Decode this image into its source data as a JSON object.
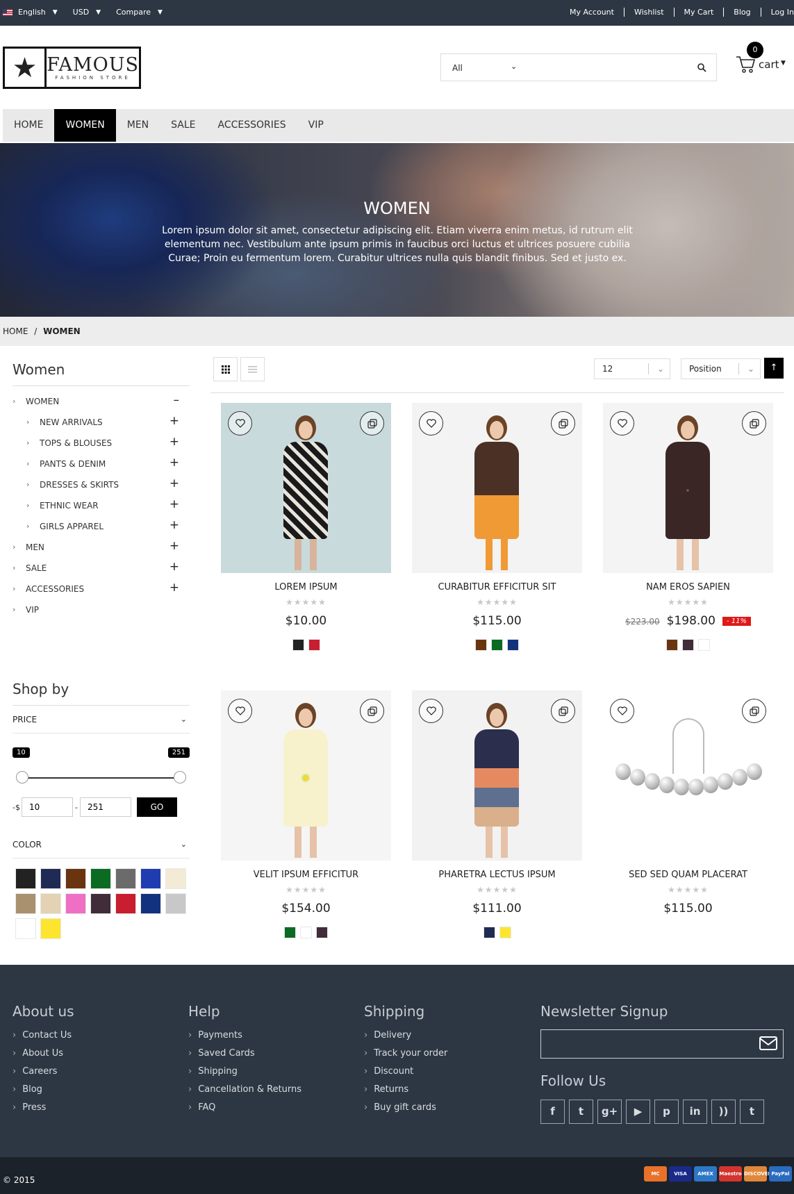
{
  "topbar": {
    "language": "English",
    "currency": "USD",
    "compare": "Compare",
    "links": [
      "My Account",
      "Wishlist",
      "My Cart",
      "Blog",
      "Log In"
    ]
  },
  "logo": {
    "name": "FAMOUS",
    "tagline": "FASHION STORE",
    "icon": "star-icon"
  },
  "search": {
    "category": "All",
    "icon": "search-icon"
  },
  "cart": {
    "count": "0",
    "label": "cart",
    "icon": "cart-icon"
  },
  "nav": {
    "items": [
      "HOME",
      "WOMEN",
      "MEN",
      "SALE",
      "ACCESSORIES",
      "VIP"
    ],
    "active": "WOMEN"
  },
  "banner": {
    "title": "WOMEN",
    "text": "Lorem ipsum dolor sit amet, consectetur adipiscing elit. Etiam viverra enim metus, id rutrum elit elementum nec. Vestibulum ante ipsum primis in faucibus orci luctus et ultrices posuere cubilia Curae; Proin eu fermentum lorem. Curabitur ultrices nulla quis blandit finibus. Sed et justo ex."
  },
  "breadcrumb": {
    "home": "HOME",
    "sep": "/",
    "current": "WOMEN"
  },
  "sidebar": {
    "title": "Women",
    "categories": [
      {
        "label": "WOMEN",
        "level": 0,
        "toggle": "–"
      },
      {
        "label": "NEW ARRIVALS",
        "level": 1,
        "toggle": "+"
      },
      {
        "label": "TOPS & BLOUSES",
        "level": 1,
        "toggle": "+"
      },
      {
        "label": "PANTS & DENIM",
        "level": 1,
        "toggle": "+"
      },
      {
        "label": "DRESSES & SKIRTS",
        "level": 1,
        "toggle": "+"
      },
      {
        "label": "ETHNIC WEAR",
        "level": 1,
        "toggle": "+"
      },
      {
        "label": "GIRLS APPAREL",
        "level": 1,
        "toggle": "+"
      },
      {
        "label": "MEN",
        "level": 0,
        "toggle": "+"
      },
      {
        "label": "SALE",
        "level": 0,
        "toggle": "+"
      },
      {
        "label": "ACCESSORIES",
        "level": 0,
        "toggle": "+"
      },
      {
        "label": "VIP",
        "level": 0,
        "toggle": ""
      }
    ]
  },
  "shopby": {
    "title": "Shop by",
    "price_label": "PRICE",
    "price_min": "10",
    "price_max": "251",
    "currency_prefix": "-$",
    "range_sep": "-",
    "go": "GO",
    "color_label": "COLOR",
    "colors": [
      "#222222",
      "#1f2a55",
      "#6b3410",
      "#0b6b22",
      "#6b6b6b",
      "#1f3cb0",
      "#f3ebd6",
      "#a9916f",
      "#e3d3b4",
      "#ef6fc4",
      "#412c39",
      "#c81e30",
      "#13327d",
      "#c8c8c8",
      "#ffffff",
      "#fde52f"
    ]
  },
  "toolbar": {
    "limit": "12",
    "sort": "Position",
    "sort_dir_icon": "arrow-up-icon",
    "grid_icon": "grid-icon",
    "list_icon": "list-icon"
  },
  "products": [
    {
      "name": "LOREM IPSUM",
      "price": "$10.00",
      "old_price": "",
      "discount": "",
      "stars": "★★★★★",
      "colors": [
        "#222222",
        "#c81e30"
      ],
      "image": "giraffe-print-dress"
    },
    {
      "name": "CURABITUR EFFICITUR SIT",
      "price": "$115.00",
      "old_price": "",
      "discount": "",
      "stars": "★★★★★",
      "colors": [
        "#6b3410",
        "#0b6b22",
        "#13327d"
      ],
      "image": "brown-top-orange-pants"
    },
    {
      "name": "NAM EROS SAPIEN",
      "price": "$198.00",
      "old_price": "$223.00",
      "discount": "- 11%",
      "stars": "★★★★★",
      "colors": [
        "#6b3410",
        "#412c39",
        "#ffffff"
      ],
      "image": "brown-printed-dress"
    },
    {
      "name": "VELIT IPSUM EFFICITUR",
      "price": "$154.00",
      "old_price": "",
      "discount": "",
      "stars": "★★★★★",
      "colors": [
        "#0b6b22",
        "#ffffff",
        "#412c39"
      ],
      "image": "yellow-floral-dress"
    },
    {
      "name": "PHARETRA LECTUS IPSUM",
      "price": "$111.00",
      "old_price": "",
      "discount": "",
      "stars": "★★★★★",
      "colors": [
        "#1f2a55",
        "#fde52f"
      ],
      "image": "striped-mini-dress"
    },
    {
      "name": "SED SED QUAM PLACERAT",
      "price": "$115.00",
      "old_price": "",
      "discount": "",
      "stars": "★★★★★",
      "colors": [],
      "image": "pearl-bracelet"
    }
  ],
  "footer": {
    "columns": [
      {
        "title": "About us",
        "links": [
          "Contact Us",
          "About Us",
          "Careers",
          "Blog",
          "Press"
        ]
      },
      {
        "title": "Help",
        "links": [
          "Payments",
          "Saved Cards",
          "Shipping",
          "Cancellation & Returns",
          "FAQ"
        ]
      },
      {
        "title": "Shipping",
        "links": [
          "Delivery",
          "Track your order",
          "Discount",
          "Returns",
          "Buy gift cards"
        ]
      }
    ],
    "newsletter_title": "Newsletter Signup",
    "follow_title": "Follow Us",
    "socials": [
      {
        "name": "facebook-icon",
        "glyph": "f"
      },
      {
        "name": "twitter-icon",
        "glyph": "t"
      },
      {
        "name": "google-plus-icon",
        "glyph": "g+"
      },
      {
        "name": "youtube-icon",
        "glyph": "▶"
      },
      {
        "name": "pinterest-icon",
        "glyph": "p"
      },
      {
        "name": "linkedin-icon",
        "glyph": "in"
      },
      {
        "name": "rss-icon",
        "glyph": "))"
      },
      {
        "name": "tumblr-icon",
        "glyph": "t"
      }
    ],
    "copyright": "© 2015",
    "payments": [
      {
        "name": "mastercard-icon",
        "label": "MC",
        "color": "#e8722a"
      },
      {
        "name": "visa-icon",
        "label": "VISA",
        "color": "#1a2a8a"
      },
      {
        "name": "amex-icon",
        "label": "AMEX",
        "color": "#2d77c8"
      },
      {
        "name": "maestro-icon",
        "label": "Maestro",
        "color": "#d2352f"
      },
      {
        "name": "discover-icon",
        "label": "DISCOVER",
        "color": "#e0873a"
      },
      {
        "name": "paypal-icon",
        "label": "PayPal",
        "color": "#2a6bbf"
      }
    ]
  }
}
